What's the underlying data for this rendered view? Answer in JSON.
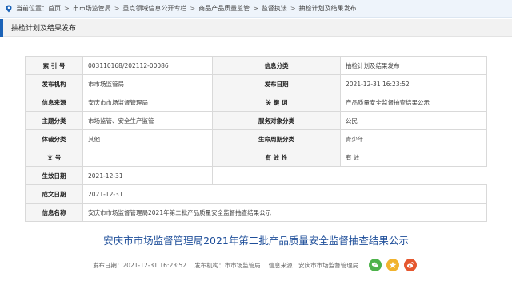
{
  "breadcrumb": {
    "prefix": "当前位置：",
    "items": [
      "首页",
      "市市场监管局",
      "重点领域信息公开专栏",
      "商品产品质量监管",
      "监督执法",
      "抽检计划及结果发布"
    ]
  },
  "section": {
    "title": "抽检计划及结果发布"
  },
  "meta": {
    "index_label": "索 引 号",
    "index_value": "003110168/202112-00086",
    "category_label": "信息分类",
    "category_value": "抽检计划及结果发布",
    "org_label": "发布机构",
    "org_value": "市市场监管局",
    "pubdate_label": "发布日期",
    "pubdate_value": "2021-12-31 16:23:52",
    "source_label": "信息来源",
    "source_value": "安庆市市场监督管理局",
    "keywords_label": "关 键 词",
    "keywords_value": "产品质量安全监督抽查结果公示",
    "topic_label": "主题分类",
    "topic_value": "市场监管、安全生产监管",
    "audience_label": "服务对象分类",
    "audience_value": "公民",
    "genre_label": "体裁分类",
    "genre_value": "其他",
    "lifecycle_label": "生命周期分类",
    "lifecycle_value": "青少年",
    "docno_label": "文 号",
    "docno_value": "",
    "validity_label": "有 效 性",
    "validity_value": "有 效",
    "effective_label": "生效日期",
    "effective_value": "2021-12-31",
    "created_label": "成文日期",
    "created_value": "2021-12-31",
    "name_label": "信息名称",
    "name_value": "安庆市市场监督管理局2021年第二批产品质量安全监督抽查结果公示"
  },
  "article": {
    "title": "安庆市市场监督管理局2021年第二批产品质量安全监督抽查结果公示",
    "pub_date": "发布日期：2021-12-31 16:23:52",
    "pub_org": "发布机构：市市场监管局",
    "info_source": "信息来源：安庆市市场监督管理局"
  },
  "colors": {
    "accent": "#1c63b7",
    "title_blue": "#1f4f9a",
    "wechat": "#4db24b",
    "qzone": "#f1b32e",
    "weibo": "#e5572f"
  },
  "icons": [
    "location-icon",
    "wechat-share-icon",
    "qzone-share-icon",
    "weibo-share-icon"
  ]
}
